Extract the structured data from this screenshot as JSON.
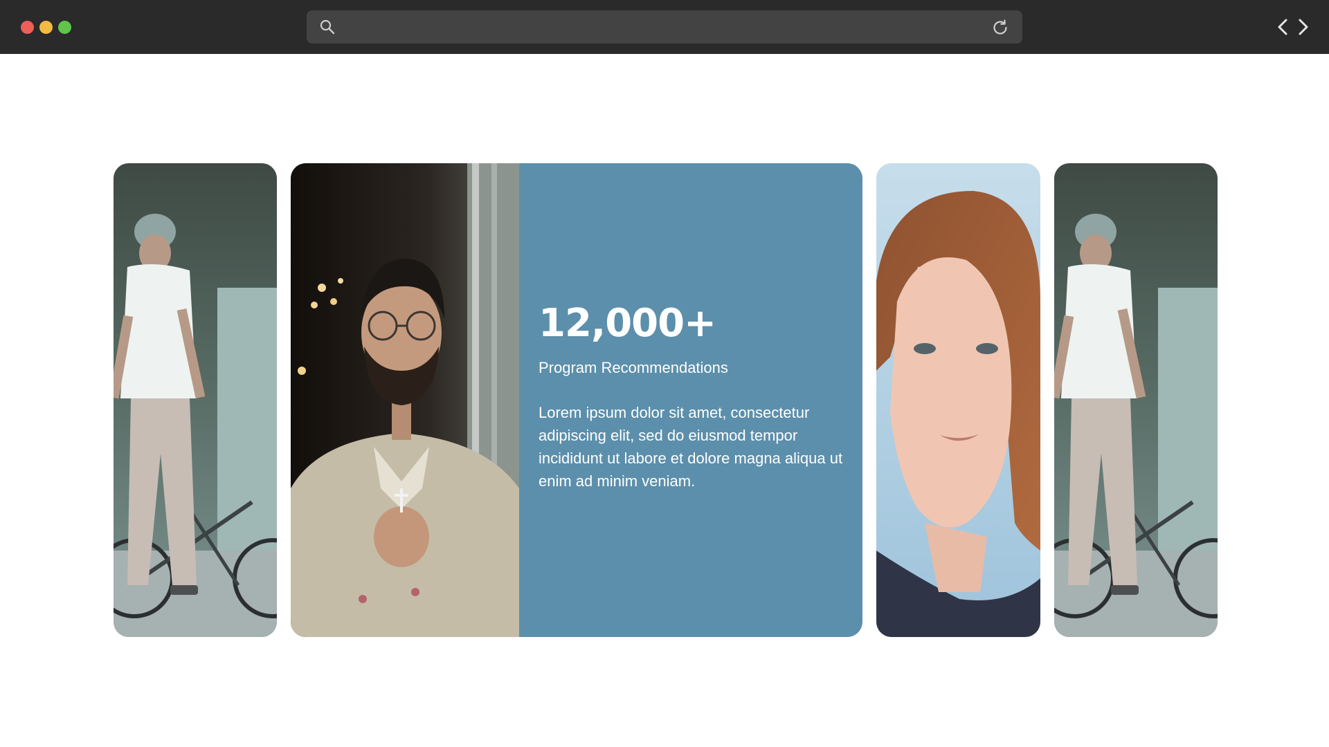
{
  "browser": {
    "controls": [
      "close",
      "minimize",
      "zoom"
    ],
    "address_placeholder": "",
    "icons": [
      "search-icon",
      "reload-icon",
      "back-arrow-icon",
      "forward-arrow-icon"
    ]
  },
  "feature": {
    "stat": "12,000+",
    "label": "Program Recommendations",
    "body": "Lorem ipsum dolor sit amet, consectetur adipiscing elit, sed do eiusmod tempor incididunt ut labore et dolore magna aliqua ut enim ad minim veniam.",
    "accent": "#5c8fab"
  },
  "gallery": {
    "photos": [
      "Man in beanie standing with a BMX bike",
      "Bearded man with glasses, hands clasped",
      "Red-haired young woman portrait",
      "Man in beanie standing with a BMX bike"
    ]
  }
}
